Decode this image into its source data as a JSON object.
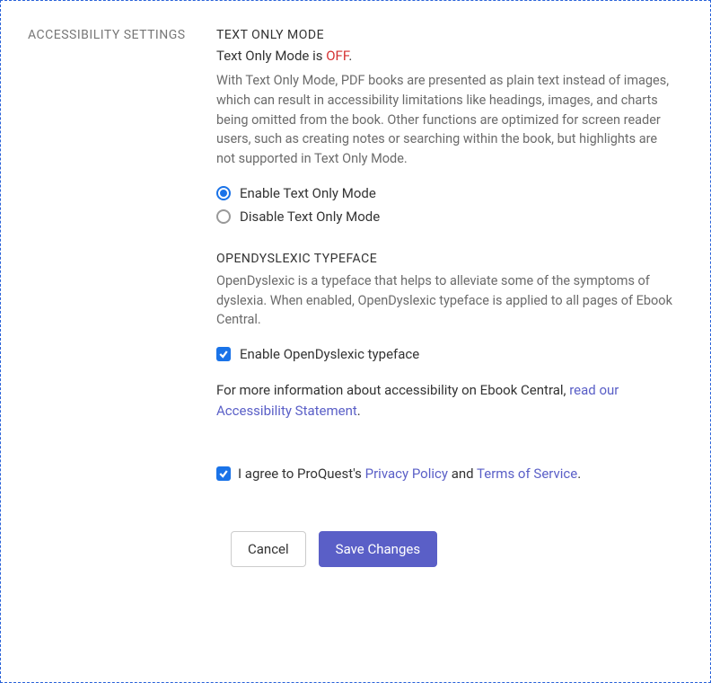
{
  "section_label": "ACCESSIBILITY SETTINGS",
  "text_only": {
    "heading": "TEXT ONLY MODE",
    "status_prefix": "Text Only Mode is ",
    "status_value": "OFF",
    "status_suffix": ".",
    "description": "With Text Only Mode, PDF books are presented as plain text instead of images, which can result in accessibility limitations like headings, images, and charts being omitted from the book. Other functions are optimized for screen reader users, such as creating notes or searching within the book, but highlights are not supported in Text Only Mode.",
    "enable_label": "Enable Text Only Mode",
    "disable_label": "Disable Text Only Mode"
  },
  "opendyslexic": {
    "heading": "OPENDYSLEXIC TYPEFACE",
    "description": "OpenDyslexic is a typeface that helps to alleviate some of the symptoms of dyslexia. When enabled, OpenDyslexic typeface is applied to all pages of Ebook Central.",
    "enable_label": "Enable OpenDyslexic typeface"
  },
  "more_info": {
    "prefix": "For more information about accessibility on Ebook Central, ",
    "link": "read our Accessibility Statement",
    "suffix": "."
  },
  "agree": {
    "prefix": "I agree to ProQuest's ",
    "privacy": "Privacy Policy",
    "and": " and ",
    "tos": "Terms of Service",
    "suffix": "."
  },
  "buttons": {
    "cancel": "Cancel",
    "save": "Save Changes"
  }
}
